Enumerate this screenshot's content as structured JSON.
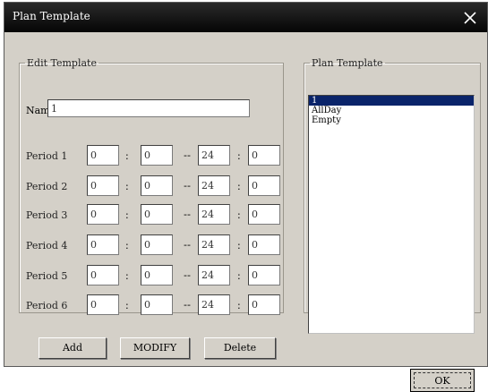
{
  "window": {
    "title": "Plan Template",
    "close_glyph": "×"
  },
  "edit_group": {
    "legend": "Edit Template",
    "name_label": "Name",
    "name_value": "1"
  },
  "periods": [
    {
      "label": "Period 1",
      "start_hour": "0",
      "start_min": "0",
      "end_hour": "24",
      "end_min": "0"
    },
    {
      "label": "Period 2",
      "start_hour": "0",
      "start_min": "0",
      "end_hour": "24",
      "end_min": "0"
    },
    {
      "label": "Period 3",
      "start_hour": "0",
      "start_min": "0",
      "end_hour": "24",
      "end_min": "0"
    },
    {
      "label": "Period 4",
      "start_hour": "0",
      "start_min": "0",
      "end_hour": "24",
      "end_min": "0"
    },
    {
      "label": "Period 5",
      "start_hour": "0",
      "start_min": "0",
      "end_hour": "24",
      "end_min": "0"
    },
    {
      "label": "Period 6",
      "start_hour": "0",
      "start_min": "0",
      "end_hour": "24",
      "end_min": "0"
    }
  ],
  "separators": {
    "colon": ":",
    "dash": "--"
  },
  "buttons": {
    "add": "Add",
    "modify": "MODIFY",
    "delete": "Delete",
    "ok": "OK"
  },
  "plan_group": {
    "legend": "Plan Template",
    "items": [
      "1",
      "AllDay",
      "Empty"
    ],
    "selected_index": 0
  },
  "colors": {
    "titlebar": "#000000",
    "dialog_bg": "#d4d0c8",
    "selection": "#0a246a"
  }
}
